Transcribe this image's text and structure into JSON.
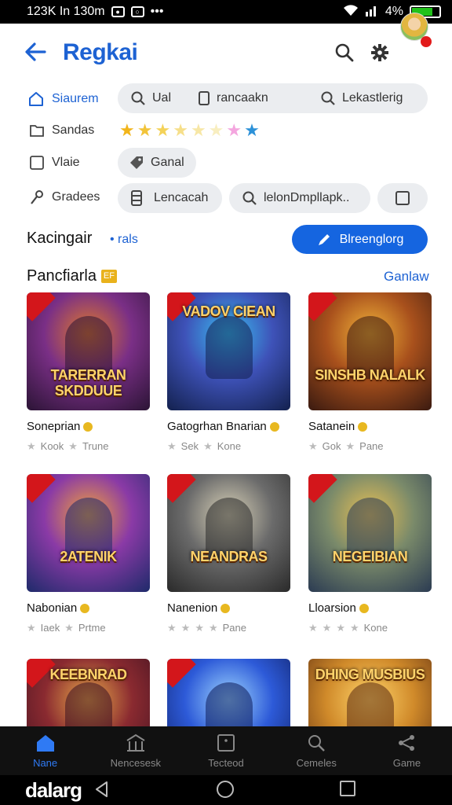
{
  "status_bar": {
    "left_text": "123K In 130m",
    "battery": "4%",
    "battery_level": 0.75
  },
  "header": {
    "title": "Regkai",
    "back_icon": "arrow-left-icon",
    "search_icon": "search-icon",
    "settings_icon": "gear-icon"
  },
  "filters": {
    "row1": {
      "label": "Siaurem",
      "chips": [
        "Ual",
        "rancaakn",
        "Lekastlerig"
      ]
    },
    "row2": {
      "label": "Sandas",
      "star_colors": [
        "#f2b51b",
        "#f2c43a",
        "#f4d259",
        "#f6df8a",
        "#f7e7a6",
        "#f8eec0",
        "#f4a6df",
        "#2c91d8"
      ]
    },
    "row3": {
      "label": "Vlaie",
      "chip": "Ganal"
    },
    "row4": {
      "label": "Gradees",
      "chips": [
        "Lencacah",
        "lelonDmpllapk.."
      ]
    }
  },
  "section1": {
    "title": "Kacingair",
    "subtitle": "• rals",
    "button": "Blreenglorg"
  },
  "section2": {
    "title": "Pancfiarla",
    "badge": "EF",
    "see_all": "Ganlaw"
  },
  "games": [
    {
      "name": "Soneprian",
      "meta1": "Kook",
      "meta2": "Trune",
      "art": "TARERRAN SKDDUUE",
      "colors": [
        "#2b1435",
        "#7a2f86",
        "#e07a2a"
      ]
    },
    {
      "name": "Gatogrhan Bnarian",
      "meta1": "Sek",
      "meta2": "Kone",
      "art": "VADOV CIEAN",
      "colors": [
        "#13214e",
        "#3e52b8",
        "#39c0f0"
      ]
    },
    {
      "name": "Satanein",
      "meta1": "Gok",
      "meta2": "Pane",
      "art": "SINSHB NALALK",
      "colors": [
        "#3a1a10",
        "#a8501c",
        "#f2b43a"
      ]
    },
    {
      "name": "Nabonian",
      "meta1": "Iaek",
      "meta2": "Prtme",
      "art": "2ATENIK",
      "colors": [
        "#1e2a6a",
        "#8a3aa6",
        "#f1a23a"
      ]
    },
    {
      "name": "Nanenion",
      "meta1": "",
      "meta2": "Pane",
      "art": "NEANDRAS",
      "colors": [
        "#2a2a2a",
        "#6b6b6b",
        "#d9d2b8"
      ]
    },
    {
      "name": "Lloarsion",
      "meta1": "",
      "meta2": "Kone",
      "art": "NEGEIBIAN",
      "colors": [
        "#2b3b52",
        "#7a8a6a",
        "#e8c055"
      ]
    },
    {
      "name": "",
      "meta1": "",
      "meta2": "",
      "art": "KEEBNRAD",
      "colors": [
        "#3a1020",
        "#8a2a30",
        "#e7a94a"
      ]
    },
    {
      "name": "",
      "meta1": "",
      "meta2": "",
      "art": "",
      "colors": [
        "#0d1b5a",
        "#2d5ad8",
        "#9fd6ff"
      ]
    },
    {
      "name": "",
      "meta1": "",
      "meta2": "",
      "art": "DHING MUSBIUS",
      "colors": [
        "#5a2a10",
        "#d08a2a",
        "#ffd46a"
      ]
    }
  ],
  "bottom_nav": [
    {
      "label": "Nane",
      "icon": "home-icon"
    },
    {
      "label": "Nencesesk",
      "icon": "bank-icon"
    },
    {
      "label": "Tecteod",
      "icon": "tablet-icon"
    },
    {
      "label": "Cemeles",
      "icon": "search-icon"
    },
    {
      "label": "Game",
      "icon": "share-icon"
    }
  ],
  "system_bar": {
    "brand": "dalarg"
  }
}
